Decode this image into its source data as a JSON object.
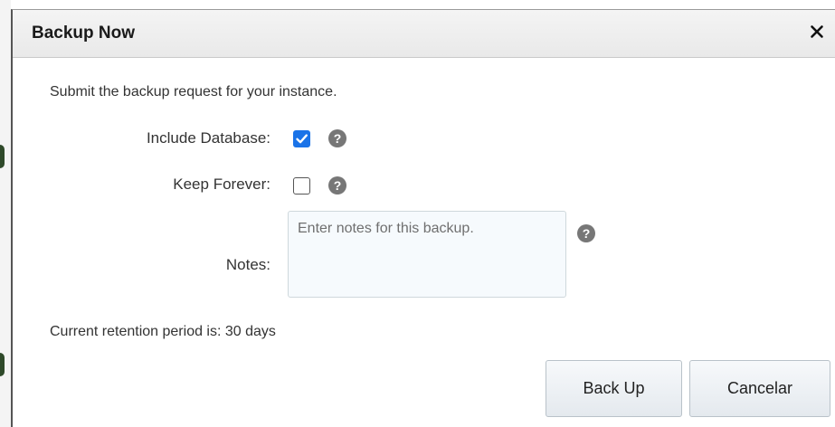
{
  "dialog": {
    "title": "Backup Now",
    "close_icon": "close-icon",
    "intro": "Submit the backup request for your instance.",
    "fields": {
      "include_database": {
        "label": "Include Database:",
        "checked": true
      },
      "keep_forever": {
        "label": "Keep Forever:",
        "checked": false
      },
      "notes": {
        "label": "Notes:",
        "value": "",
        "placeholder": "Enter notes for this backup."
      }
    },
    "help_icon": "help-icon",
    "retention_text": "Current retention period is: 30 days",
    "buttons": {
      "back_up": "Back Up",
      "cancel": "Cancelar"
    }
  },
  "colors": {
    "checkbox_checked": "#1a73e8",
    "help_icon_bg": "#777777",
    "titlebar_bg": "#efefef"
  }
}
